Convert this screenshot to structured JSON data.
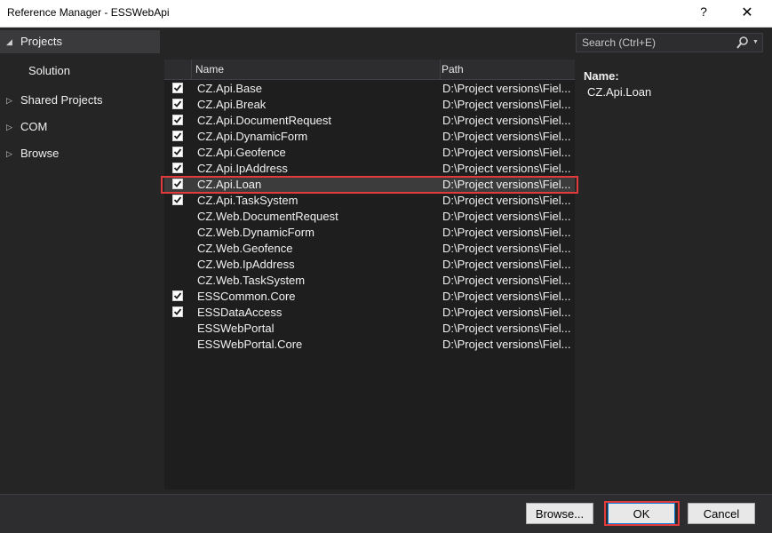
{
  "window": {
    "title": "Reference Manager - ESSWebApi",
    "help_label": "?",
    "close_label": "✕"
  },
  "sidebar": {
    "items": [
      {
        "label": "Projects",
        "arrow": "◢",
        "selected": true
      },
      {
        "label": "Solution",
        "arrow": "",
        "selected": false
      },
      {
        "label": "Shared Projects",
        "arrow": "▷",
        "selected": false
      },
      {
        "label": "COM",
        "arrow": "▷",
        "selected": false
      },
      {
        "label": "Browse",
        "arrow": "▷",
        "selected": false
      }
    ]
  },
  "search": {
    "placeholder": "Search (Ctrl+E)"
  },
  "list": {
    "columns": {
      "name": "Name",
      "path": "Path"
    },
    "rows": [
      {
        "name": "CZ.Api.Base",
        "path": "D:\\Project versions\\Fiel...",
        "checked": true
      },
      {
        "name": "CZ.Api.Break",
        "path": "D:\\Project versions\\Fiel...",
        "checked": true
      },
      {
        "name": "CZ.Api.DocumentRequest",
        "path": "D:\\Project versions\\Fiel...",
        "checked": true
      },
      {
        "name": "CZ.Api.DynamicForm",
        "path": "D:\\Project versions\\Fiel...",
        "checked": true
      },
      {
        "name": "CZ.Api.Geofence",
        "path": "D:\\Project versions\\Fiel...",
        "checked": true
      },
      {
        "name": "CZ.Api.IpAddress",
        "path": "D:\\Project versions\\Fiel...",
        "checked": true
      },
      {
        "name": "CZ.Api.Loan",
        "path": "D:\\Project versions\\Fiel...",
        "checked": true,
        "selected": true
      },
      {
        "name": "CZ.Api.TaskSystem",
        "path": "D:\\Project versions\\Fiel...",
        "checked": true
      },
      {
        "name": "CZ.Web.DocumentRequest",
        "path": "D:\\Project versions\\Fiel...",
        "checked": false
      },
      {
        "name": "CZ.Web.DynamicForm",
        "path": "D:\\Project versions\\Fiel...",
        "checked": false
      },
      {
        "name": "CZ.Web.Geofence",
        "path": "D:\\Project versions\\Fiel...",
        "checked": false
      },
      {
        "name": "CZ.Web.IpAddress",
        "path": "D:\\Project versions\\Fiel...",
        "checked": false
      },
      {
        "name": "CZ.Web.TaskSystem",
        "path": "D:\\Project versions\\Fiel...",
        "checked": false
      },
      {
        "name": "ESSCommon.Core",
        "path": "D:\\Project versions\\Fiel...",
        "checked": true
      },
      {
        "name": "ESSDataAccess",
        "path": "D:\\Project versions\\Fiel...",
        "checked": true
      },
      {
        "name": "ESSWebPortal",
        "path": "D:\\Project versions\\Fiel...",
        "checked": false
      },
      {
        "name": "ESSWebPortal.Core",
        "path": "D:\\Project versions\\Fiel...",
        "checked": false
      }
    ]
  },
  "details": {
    "name_label": "Name:",
    "name_value": "CZ.Api.Loan"
  },
  "footer": {
    "browse_label": "Browse...",
    "ok_label": "OK",
    "cancel_label": "Cancel"
  },
  "colors": {
    "background": "#252526",
    "list_background": "#1e1e1e",
    "highlight": "#e23b3b",
    "accent": "#0078d4"
  }
}
